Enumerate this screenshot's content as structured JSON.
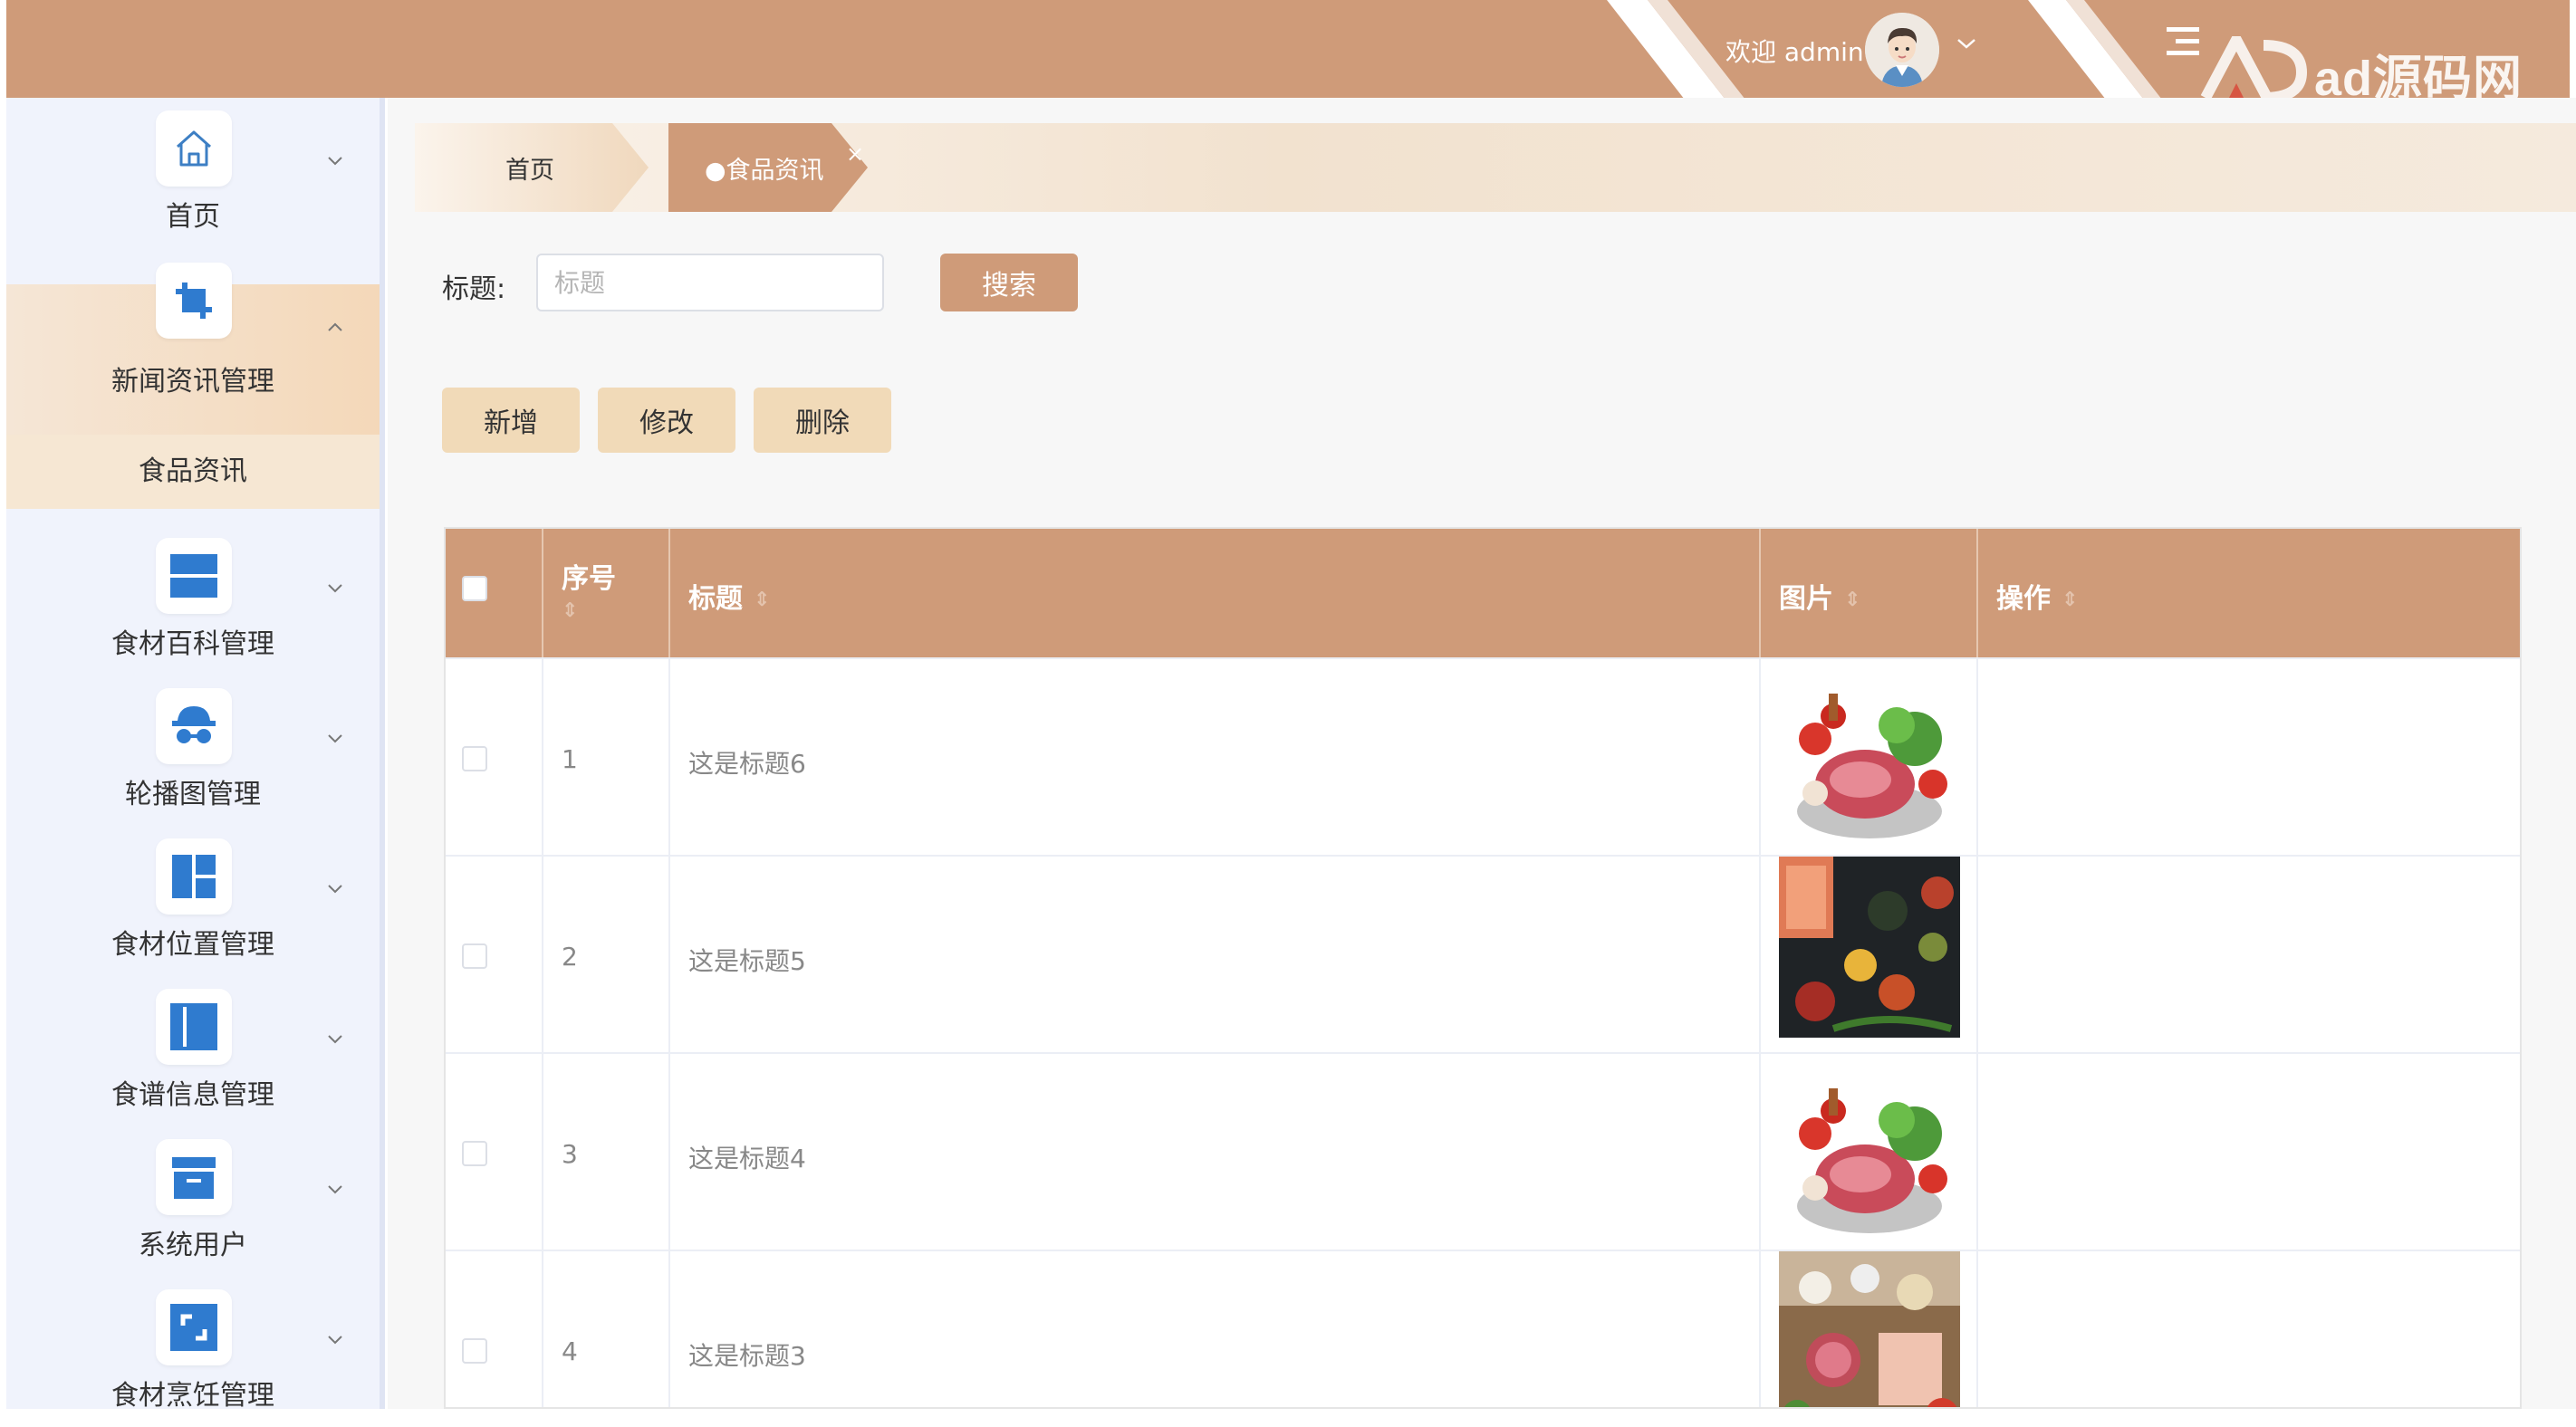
{
  "header": {
    "welcome": "欢迎 admin",
    "brand": "ad源码网",
    "accent": "#cf9b79"
  },
  "sidebar": {
    "items": [
      {
        "label": "首页",
        "icon": "home-icon"
      },
      {
        "label": "新闻资讯管理",
        "icon": "crop-icon",
        "expanded": true
      },
      {
        "label": "食材百科管理",
        "icon": "panels-icon"
      },
      {
        "label": "轮播图管理",
        "icon": "incognito-icon"
      },
      {
        "label": "食材位置管理",
        "icon": "dashboard-icon"
      },
      {
        "label": "食谱信息管理",
        "icon": "column-layout-icon"
      },
      {
        "label": "系统用户",
        "icon": "archive-icon"
      },
      {
        "label": "食材烹饪管理",
        "icon": "frame-icon"
      }
    ],
    "subitem": "食品资讯"
  },
  "tabs": {
    "home": "首页",
    "active": "●食品资讯",
    "close": "×"
  },
  "search": {
    "label": "标题:",
    "placeholder": "标题",
    "value": "",
    "button": "搜索"
  },
  "actions": {
    "add": "新增",
    "edit": "修改",
    "delete": "删除"
  },
  "table": {
    "headers": {
      "index": "序号",
      "title": "标题",
      "image": "图片",
      "operation": "操作"
    },
    "sort_glyph": "⇕",
    "rows": [
      {
        "index": "1",
        "title": "这是标题6"
      },
      {
        "index": "2",
        "title": "这是标题5"
      },
      {
        "index": "3",
        "title": "这是标题4"
      },
      {
        "index": "4",
        "title": "这是标题3"
      }
    ]
  }
}
